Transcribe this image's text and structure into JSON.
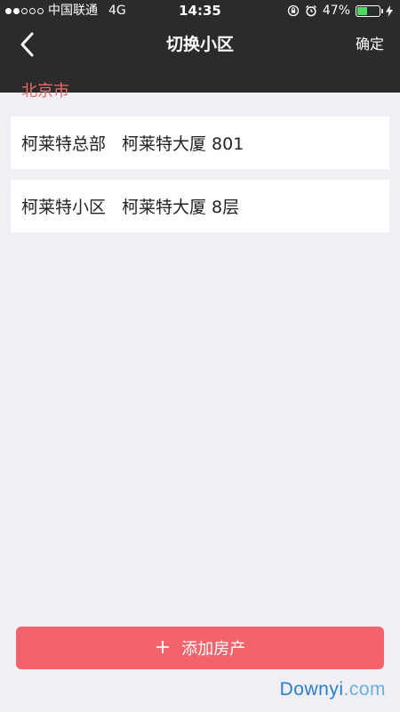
{
  "status_bar": {
    "carrier": "中国联通",
    "network": "4G",
    "time": "14:35",
    "battery_percent": "47%",
    "battery_level": 0.47
  },
  "nav": {
    "title": "切换小区",
    "confirm_label": "确定"
  },
  "city": "北京市",
  "communities": [
    {
      "name": "柯莱特总部",
      "address": "柯莱特大厦 801"
    },
    {
      "name": "柯莱特小区",
      "address": "柯莱特大厦 8层"
    }
  ],
  "add_button": {
    "label": "添加房产"
  },
  "watermark": {
    "brand": "Downyi",
    "tld": ".com"
  },
  "colors": {
    "header_bg": "#2c2a2a",
    "accent": "#f2636b",
    "city_label": "#e86d6d",
    "page_bg": "#f0eff5"
  }
}
